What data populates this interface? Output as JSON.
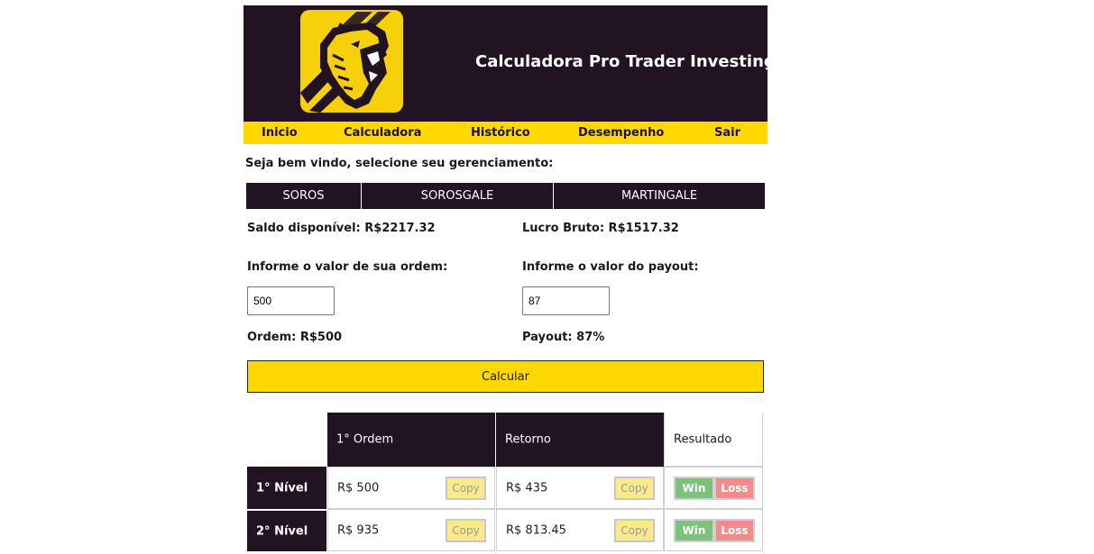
{
  "header": {
    "title": "Calculadora Pro Trader Investing",
    "logo": "bear-logo-icon"
  },
  "nav": {
    "items": [
      "Inicio",
      "Calculadora",
      "Histórico",
      "Desempenho",
      "Sair"
    ]
  },
  "welcome": "Seja bem vindo, selecione seu gerenciamento:",
  "tabs": [
    "SOROS",
    "SOROSGALE",
    "MARTINGALE"
  ],
  "balance": {
    "saldo": "Saldo disponível: R$2217.32",
    "lucro": "Lucro Bruto: R$1517.32"
  },
  "form": {
    "order_label": "Informe o valor de sua ordem:",
    "order_value": "500",
    "payout_label": "Informe o valor do payout:",
    "payout_value": "87",
    "order_display": "Ordem: R$500",
    "payout_display": "Payout: 87%",
    "calc_button": "Calcular"
  },
  "table": {
    "headers": [
      "",
      "1° Ordem",
      "Retorno",
      "Resultado"
    ],
    "copy_label": "Copy",
    "win_label": "Win",
    "loss_label": "Loss",
    "rows": [
      {
        "level": "1° Nível",
        "order": "R$ 500",
        "return": "R$ 435"
      },
      {
        "level": "2° Nível",
        "order": "R$ 935",
        "return": "R$ 813.45"
      }
    ]
  },
  "colors": {
    "dark": "#221323",
    "accent": "#ffd800",
    "win": "#7dc27a",
    "loss": "#f28b8b"
  }
}
